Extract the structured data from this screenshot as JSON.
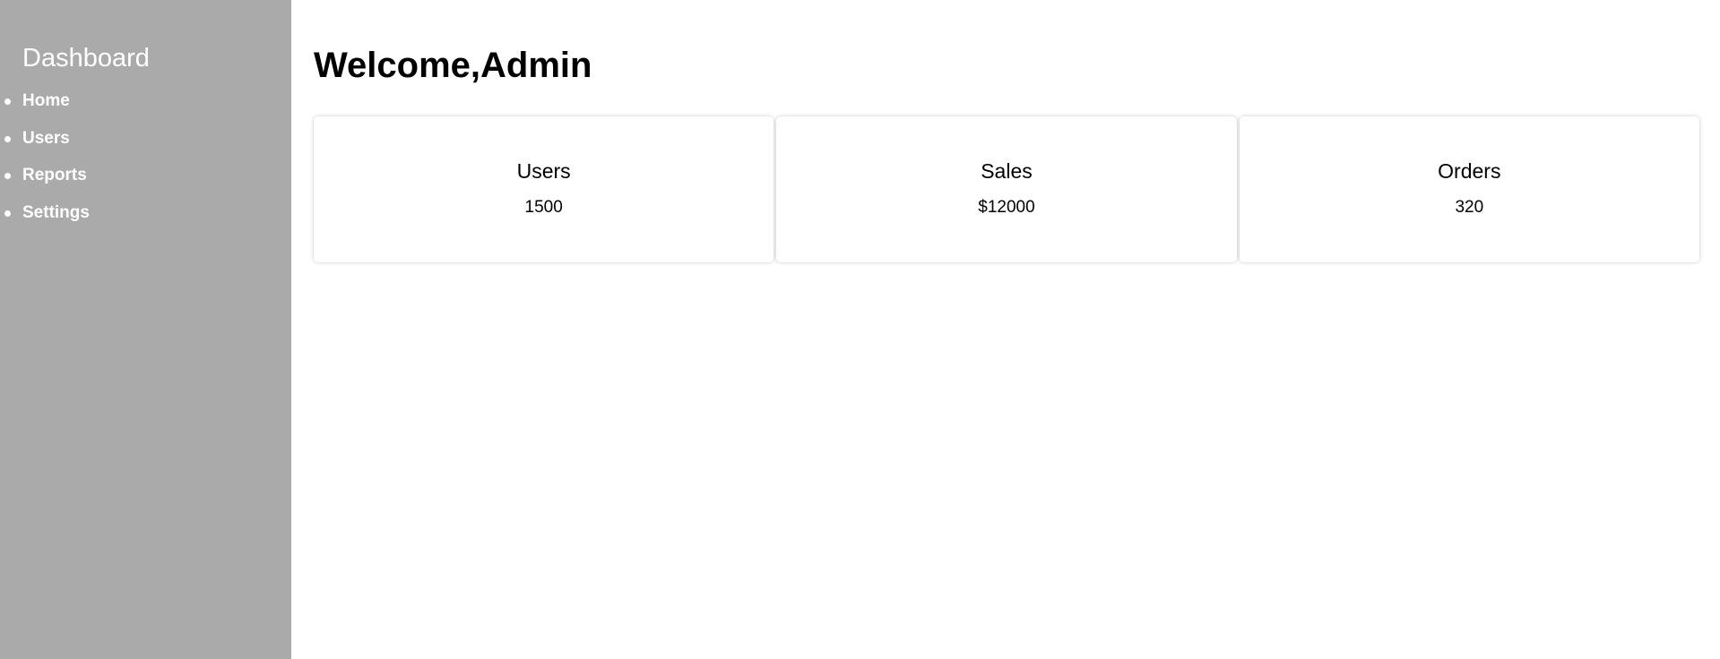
{
  "sidebar": {
    "title": "Dashboard",
    "items": [
      {
        "label": "Home"
      },
      {
        "label": "Users"
      },
      {
        "label": "Reports"
      },
      {
        "label": "Settings"
      }
    ]
  },
  "main": {
    "title": "Welcome,Admin",
    "cards": [
      {
        "label": "Users",
        "value": "1500"
      },
      {
        "label": "Sales",
        "value": "$12000"
      },
      {
        "label": "Orders",
        "value": "320"
      }
    ]
  },
  "colors": {
    "sidebar_bg": "#aaaaaa",
    "sidebar_text": "#ffffff",
    "main_bg": "#ffffff",
    "text": "#000000"
  }
}
